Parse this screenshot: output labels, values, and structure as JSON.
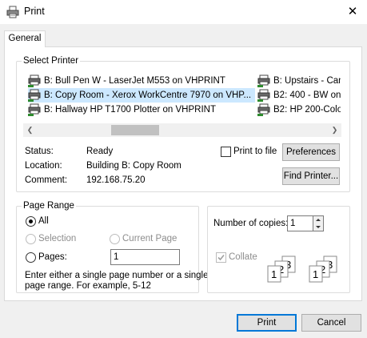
{
  "window": {
    "title": "Print",
    "close_glyph": "✕",
    "icon": "printer-icon"
  },
  "tabs": [
    {
      "label": "General",
      "selected": true
    }
  ],
  "select_printer": {
    "group_label": "Select Printer",
    "printers": [
      {
        "label": "B: Bull Pen W - LaserJet M553 on VHPRINT",
        "selected": false
      },
      {
        "label": "B: Copy Room - Xerox WorkCentre 7970 on VHP...",
        "selected": true
      },
      {
        "label": "B: Hallway HP T1700 Plotter on VHPRINT",
        "selected": false
      },
      {
        "label": "B: Upstairs - Can",
        "selected": false
      },
      {
        "label": "B2: 400 - BW on",
        "selected": false
      },
      {
        "label": "B2: HP 200-Colo",
        "selected": false
      }
    ],
    "scroll_left_glyph": "❮",
    "scroll_right_glyph": "❯",
    "status_label": "Status:",
    "status_value": "Ready",
    "location_label": "Location:",
    "location_value": "Building B: Copy Room",
    "comment_label": "Comment:",
    "comment_value": "192.168.75.20",
    "print_to_file_label": "Print to file",
    "print_to_file_checked": false,
    "preferences_label": "Preferences",
    "find_printer_label": "Find Printer..."
  },
  "page_range": {
    "group_label": "Page Range",
    "all_label": "All",
    "selection_label": "Selection",
    "current_page_label": "Current Page",
    "pages_label": "Pages:",
    "pages_value": "1",
    "selected_option": "All",
    "help_text_line1": "Enter either a single page number or a single",
    "help_text_line2": "page range.  For example, 5-12"
  },
  "copies": {
    "number_label": "Number of copies:",
    "number_value": "1",
    "collate_label": "Collate",
    "collate_checked": true,
    "collate_enabled": false
  },
  "buttons": {
    "print_label": "Print",
    "cancel_label": "Cancel"
  },
  "colors": {
    "selection_bg": "#cce8ff",
    "default_button_border": "#0078d7",
    "dialog_bg": "#f0f0f0"
  }
}
